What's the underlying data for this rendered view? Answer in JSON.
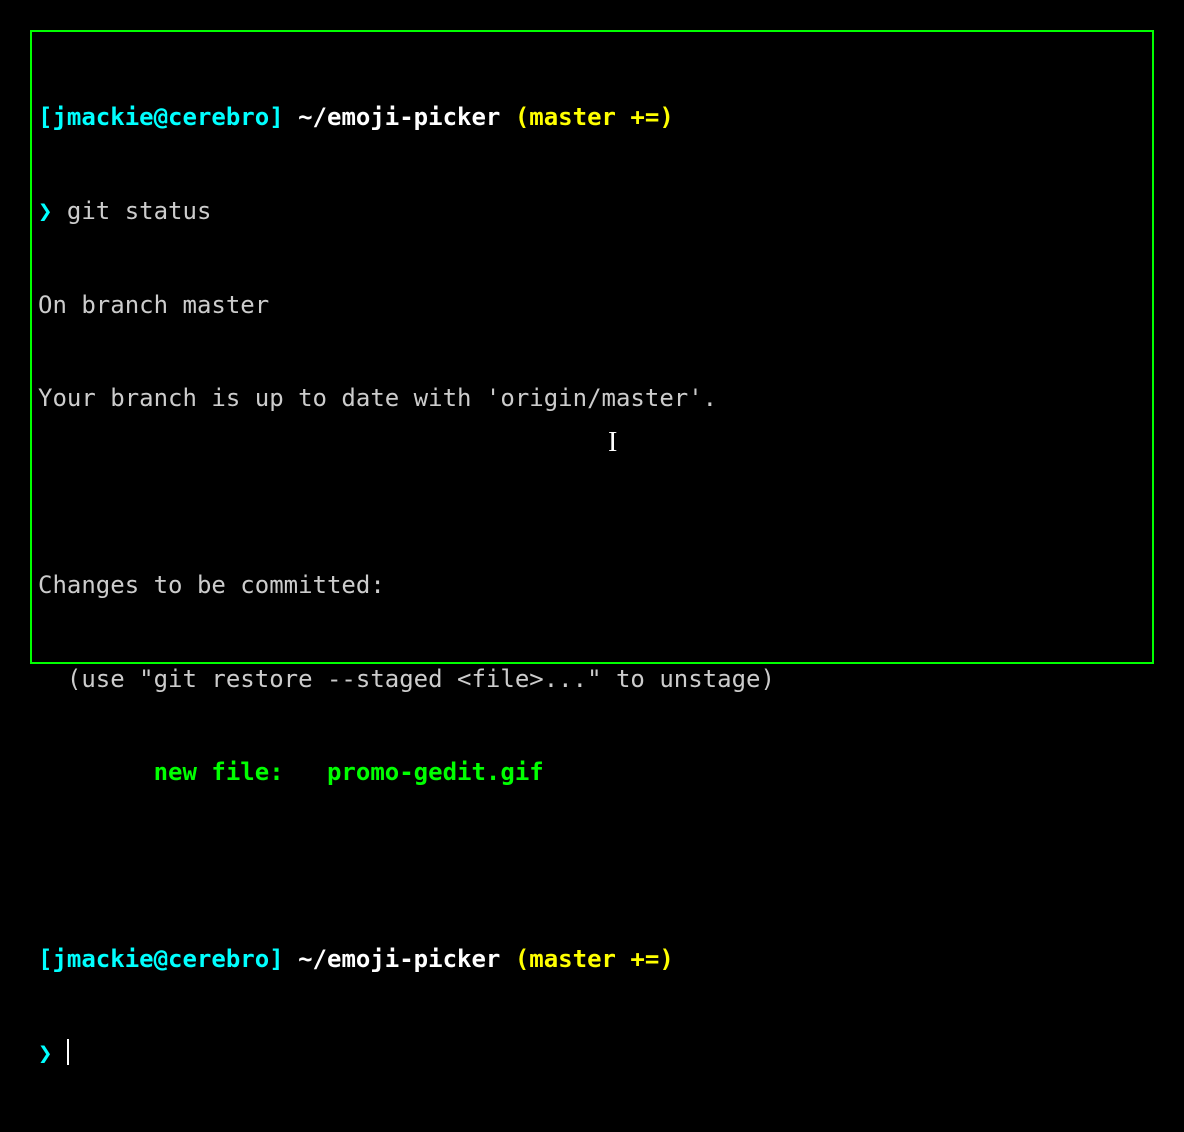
{
  "prompt1": {
    "user_host": "[jmackie@cerebro]",
    "path": " ~/emoji-picker ",
    "branch": "(master +=)",
    "symbol": "❯ "
  },
  "command1": "git status",
  "output": {
    "line1": "On branch master",
    "line2": "Your branch is up to date with 'origin/master'.",
    "blank1": "",
    "line3": "Changes to be committed:",
    "line4": "  (use \"git restore --staged <file>...\" to unstage)",
    "staged_indent": "        ",
    "staged_label": "new file:   ",
    "staged_file": "promo-gedit.gif",
    "blank2": ""
  },
  "prompt2": {
    "user_host": "[jmackie@cerebro]",
    "path": " ~/emoji-picker ",
    "branch": "(master +=)",
    "symbol": "❯ "
  },
  "mouse_cursor": "I"
}
